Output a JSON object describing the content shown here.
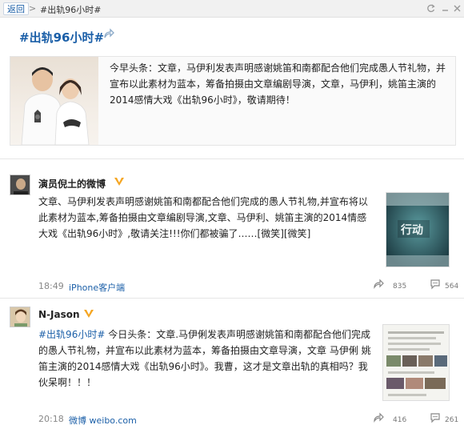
{
  "topbar": {
    "back_label": "返回",
    "breadcrumb_sep": ">",
    "breadcrumb": "#出轨96小时#"
  },
  "topic": {
    "title": "#出轨96小时#",
    "text": "今早头条：文章，马伊利发表声明感谢姚笛和南都配合他们完成愚人节礼物，并宣布以此素材为蓝本，筹备拍摄由文章编剧导演，文章，马伊利，姚笛主演的2014感情大戏《出轨96小时》，敬请期待！"
  },
  "posts": [
    {
      "author": "演员倪土的微博",
      "hashtag": "",
      "text": "文章、马伊利发表声明感谢姚笛和南都配合他们完成的愚人节礼物,并宣布将以此素材为蓝本,筹备拍摄由文章编剧导演,文章、马伊利、姚笛主演的2014情感大戏《出轨96小时》,敬请关注!!!你们都被骗了……[微笑][微笑]",
      "thumb_text": "行动",
      "time": "18:49",
      "source": "iPhone客户端",
      "repost_count": "835",
      "comment_count": "564"
    },
    {
      "author": "N-Jason",
      "hashtag": "#出轨96小时#",
      "text": " 今日头条：文章.马伊俐发表声明感谢姚笛和南都配合他们完成的愚人节礼物，并宣布以此素材为蓝本，筹备拍摄由文章导演，文章 马伊俐 姚笛主演的2014感情大戏《出轨96小时》。我曹，这才是文章出轨的真相吗？我伙呆啊！！！",
      "time": "20:18",
      "source": "微博 weibo.com",
      "repost_count": "416",
      "comment_count": "261"
    }
  ],
  "colors": {
    "link": "#1b5fa8",
    "verify": "#f5a623",
    "topbar": "#f1f1f1"
  }
}
